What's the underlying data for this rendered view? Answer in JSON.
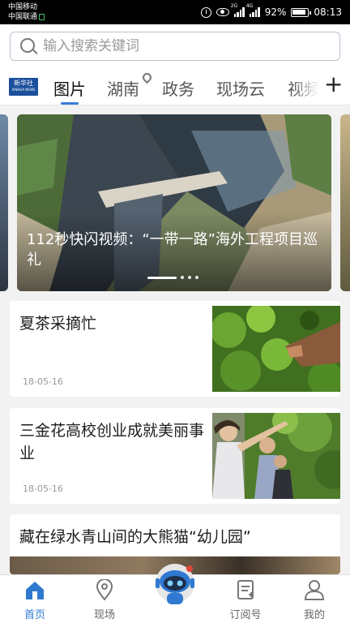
{
  "status_bar": {
    "carrier_1": "中国移动",
    "carrier_2": "中国联通",
    "network_1": "2G",
    "network_2": "4G",
    "battery": "92%",
    "time": "08:13",
    "icons": [
      "alarm-icon",
      "eye-icon",
      "signal-icon",
      "battery-icon"
    ]
  },
  "search": {
    "placeholder": "输入搜索关键词"
  },
  "logo": {
    "text": "新华社",
    "sub": "XINHUA NEWS"
  },
  "tabs": [
    {
      "label": "图片",
      "active": true
    },
    {
      "label": "湖南",
      "icon": "location-pin-icon"
    },
    {
      "label": "政务"
    },
    {
      "label": "现场云"
    },
    {
      "label": "视频"
    }
  ],
  "add_channel": "+",
  "carousel": {
    "title": "112秒快闪视频：“一带一路”海外工程项目巡礼",
    "dots_total": 4,
    "active_dot": 1
  },
  "news": [
    {
      "title": "夏茶采摘忙",
      "date": "18-05-16"
    },
    {
      "title": "三金花高校创业成就美丽事业",
      "date": "18-05-16"
    },
    {
      "title": "藏在绿水青山间的大熊猫“幼儿园”"
    }
  ],
  "bottom_nav": [
    {
      "label": "首页",
      "icon": "home-icon",
      "active": true
    },
    {
      "label": "现场",
      "icon": "location-icon"
    },
    {
      "label": "",
      "icon": "robot-assistant-icon"
    },
    {
      "label": "订阅号",
      "icon": "subscribe-icon"
    },
    {
      "label": "我的",
      "icon": "profile-icon"
    }
  ],
  "colors": {
    "accent": "#2f79d0",
    "logo_bg": "#1a4f9c"
  }
}
